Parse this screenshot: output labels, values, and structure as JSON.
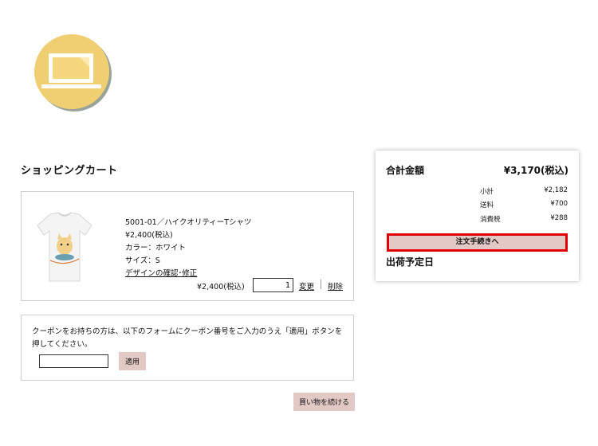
{
  "header": {
    "logo_icon": "laptop-icon"
  },
  "cart": {
    "title": "ショッピングカート",
    "item": {
      "image_icon": "tshirt-cat-image",
      "code_name": "5001-01／ハイクオリティーTシャツ",
      "unit_price": "¥2,400(税込)",
      "color": "カラー：ホワイト",
      "size": "サイズ：S",
      "design_link": "デザインの確認･修正",
      "line_total": "¥2,400(税込)",
      "quantity": "1",
      "change_link": "変更",
      "delete_link": "削除"
    }
  },
  "coupon": {
    "message": "クーポンをお持ちの方は、以下のフォームにクーポン番号をご入力のうえ「適用」ボタンを押してください。",
    "input_value": "",
    "apply_label": "適用"
  },
  "continue_label": "買い物を続ける",
  "summary": {
    "title": "合計金額",
    "total": "¥3,170(税込)",
    "rows": [
      {
        "label": "小計",
        "value": "¥2,182"
      },
      {
        "label": "送料",
        "value": "¥700"
      },
      {
        "label": "消費税",
        "value": "¥288"
      }
    ],
    "order_label": "注文手続きへ",
    "ship_date_label": "出荷予定日"
  },
  "colors": {
    "logo_circle": "#f0cf73",
    "logo_shadow": "#9aa39a",
    "button_pink": "#e3c9c5",
    "highlight_red": "#e00000"
  }
}
